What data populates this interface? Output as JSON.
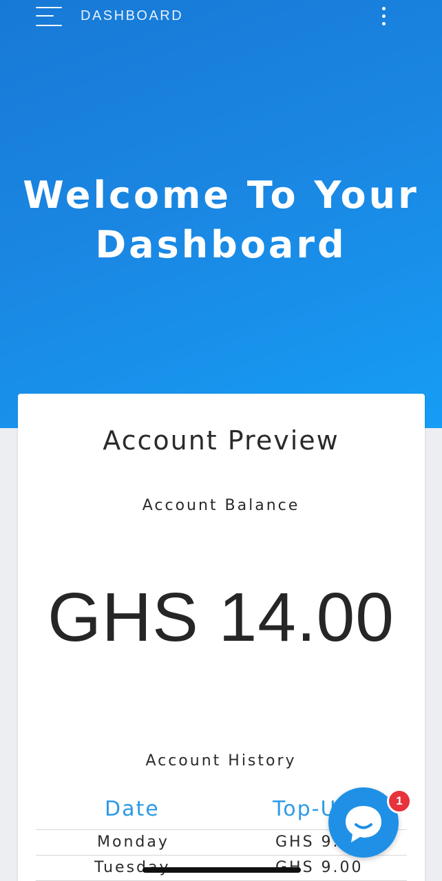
{
  "topbar": {
    "title": "DASHBOARD",
    "menu_icon": "hamburger-icon",
    "more_icon": "more-vertical-icon"
  },
  "hero": {
    "title_line1": "Welcome To Your",
    "title_line2": "Dashboard"
  },
  "card": {
    "title": "Account Preview",
    "balance_label": "Account Balance",
    "balance_value": "GHS 14.00",
    "history_label": "Account History"
  },
  "history": {
    "columns": [
      "Date",
      "Top-Up"
    ],
    "rows": [
      {
        "date": "Monday",
        "amount": "GHS 9.00"
      },
      {
        "date": "Tuesday",
        "amount": "GHS 9.00"
      }
    ]
  },
  "chat": {
    "icon": "chat-bubble-icon",
    "badge_count": "1"
  },
  "colors": {
    "hero_start": "#1779d6",
    "hero_end": "#169df5",
    "accent": "#2d9be6",
    "badge": "#e8323c"
  }
}
